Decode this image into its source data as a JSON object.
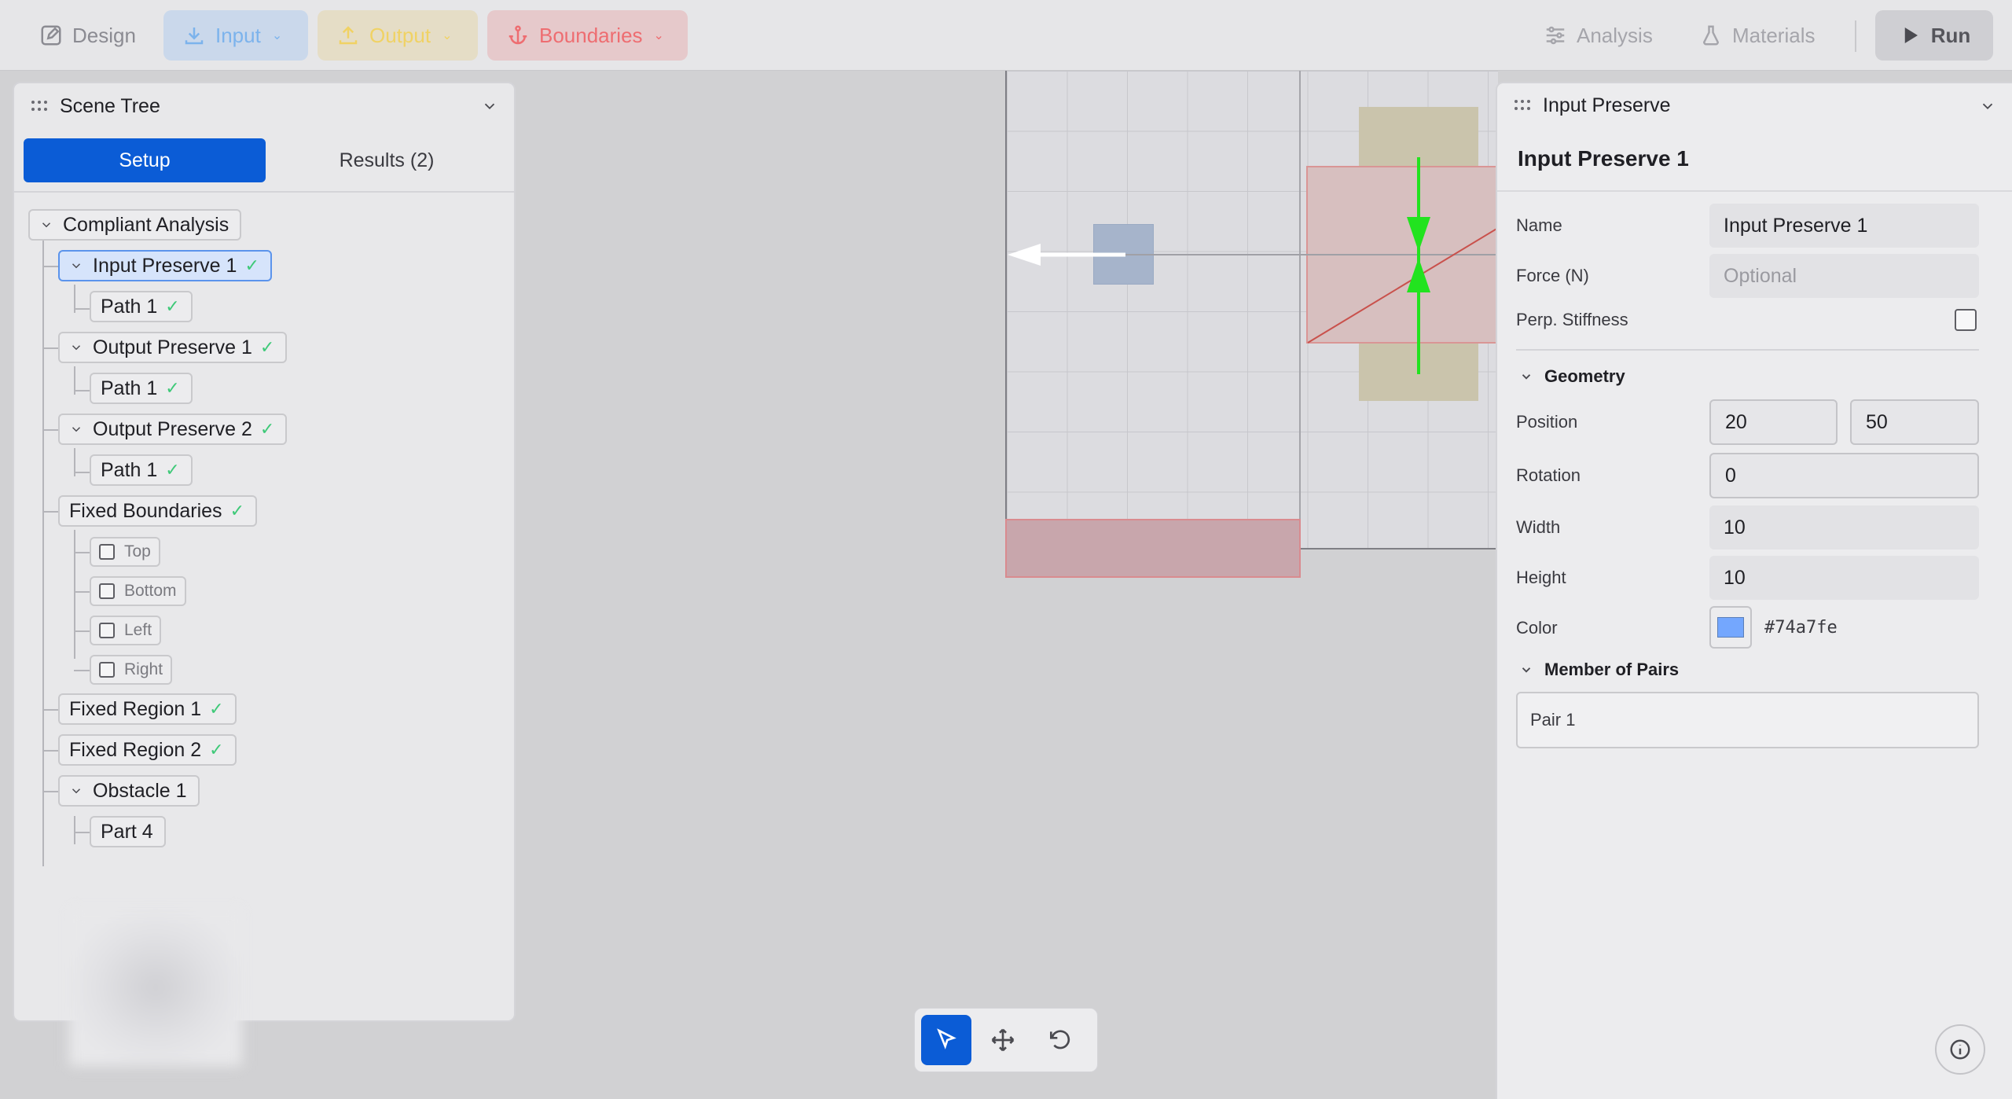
{
  "toolbar": {
    "design": "Design",
    "input": "Input",
    "output": "Output",
    "boundaries": "Boundaries",
    "analysis": "Analysis",
    "materials": "Materials",
    "run": "Run"
  },
  "scene_tree": {
    "title": "Scene Tree",
    "tabs": [
      "Setup",
      "Results (2)"
    ],
    "nodes": {
      "root": "Compliant Analysis",
      "input_preserve_1": "Input Preserve 1",
      "ip1_path": "Path 1",
      "output_preserve_1": "Output Preserve 1",
      "op1_path": "Path 1",
      "output_preserve_2": "Output Preserve 2",
      "op2_path": "Path 1",
      "fixed_boundaries": "Fixed Boundaries",
      "fb_top": "Top",
      "fb_bottom": "Bottom",
      "fb_left": "Left",
      "fb_right": "Right",
      "fixed_region_1": "Fixed Region 1",
      "fixed_region_2": "Fixed Region 2",
      "obstacle_1": "Obstacle 1",
      "part_4": "Part 4"
    }
  },
  "properties": {
    "header": "Input Preserve",
    "subtitle": "Input Preserve 1",
    "name_label": "Name",
    "name_value": "Input Preserve 1",
    "force_label": "Force (N)",
    "force_placeholder": "Optional",
    "stiffness_label": "Perp. Stiffness",
    "geometry_title": "Geometry",
    "position_label": "Position",
    "position_x": "20",
    "position_y": "50",
    "rotation_label": "Rotation",
    "rotation_value": "0",
    "width_label": "Width",
    "width_value": "10",
    "height_label": "Height",
    "height_value": "10",
    "color_label": "Color",
    "color_value": "#74a7fe",
    "pairs_title": "Member of Pairs",
    "pair_item": "Pair 1"
  },
  "colors": {
    "accent": "#0b5cd6",
    "check": "#3ec978",
    "vector": "#22e31f"
  }
}
